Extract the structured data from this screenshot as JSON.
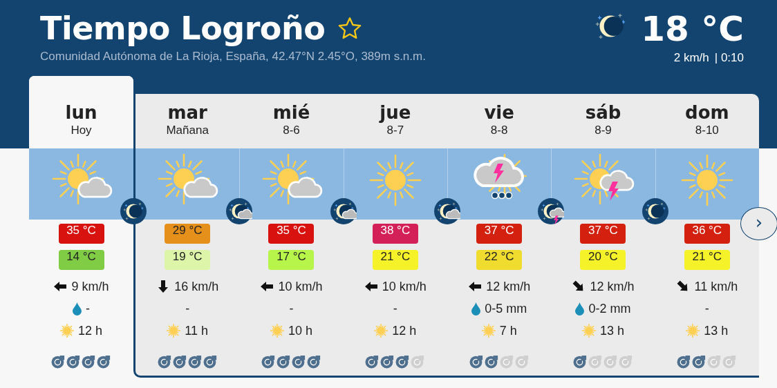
{
  "header": {
    "title": "Tiempo Logroño",
    "favorite": false,
    "subtitle": "Comunidad Autónoma de La Rioja, España, 42.47°N 2.45°O, 389m s.n.m.",
    "current": {
      "icon": {
        "kind": "moon"
      },
      "temperature": "18 °C",
      "wind": "2 km/h",
      "time": "| 0:10"
    }
  },
  "days": [
    {
      "name": "lun",
      "date": "Hoy",
      "selected": true,
      "weather_icon": {
        "kind": "sun_cloud"
      },
      "night_icon": {
        "kind": "moon"
      },
      "max": {
        "text": "35 °C",
        "color": "#d7120f"
      },
      "min": {
        "text": "14 °C",
        "color": "#80cc45"
      },
      "wind": "9 km/h",
      "wind_arrow": {
        "kind": "west"
      },
      "rain": "-",
      "rain_drop": true,
      "sun": "12 h",
      "stars": 4
    },
    {
      "name": "mar",
      "date": "Mañana",
      "selected": false,
      "weather_icon": {
        "kind": "sun_cloud"
      },
      "night_icon": {
        "kind": "moon_cloud"
      },
      "max": {
        "text": "29 °C",
        "color": "#e6901c"
      },
      "min": {
        "text": "19 °C",
        "color": "#dcf5a9"
      },
      "wind": "16 km/h",
      "wind_arrow": {
        "kind": "south"
      },
      "rain": "-",
      "rain_drop": false,
      "sun": "11 h",
      "stars": 4
    },
    {
      "name": "mié",
      "date": "8-6",
      "selected": false,
      "weather_icon": {
        "kind": "sun_cloud"
      },
      "night_icon": {
        "kind": "moon_cloud"
      },
      "max": {
        "text": "35 °C",
        "color": "#d7120f"
      },
      "min": {
        "text": "17 °C",
        "color": "#b8f54a"
      },
      "wind": "10 km/h",
      "wind_arrow": {
        "kind": "west"
      },
      "rain": "-",
      "rain_drop": false,
      "sun": "10 h",
      "stars": 4
    },
    {
      "name": "jue",
      "date": "8-7",
      "selected": false,
      "weather_icon": {
        "kind": "sun"
      },
      "night_icon": {
        "kind": "moon_cloud"
      },
      "max": {
        "text": "38 °C",
        "color": "#d42059"
      },
      "min": {
        "text": "21 °C",
        "color": "#f5f22a"
      },
      "wind": "10 km/h",
      "wind_arrow": {
        "kind": "west"
      },
      "rain": "-",
      "rain_drop": false,
      "sun": "12 h",
      "stars": 3
    },
    {
      "name": "vie",
      "date": "8-8",
      "selected": false,
      "weather_icon": {
        "kind": "storm_rain"
      },
      "night_icon": {
        "kind": "moon_storm"
      },
      "max": {
        "text": "37 °C",
        "color": "#d4210f"
      },
      "min": {
        "text": "22 °C",
        "color": "#efdc2f"
      },
      "wind": "12 km/h",
      "wind_arrow": {
        "kind": "west"
      },
      "rain": "0-5 mm",
      "rain_drop": true,
      "sun": "7 h",
      "stars": 2
    },
    {
      "name": "sáb",
      "date": "8-9",
      "selected": false,
      "weather_icon": {
        "kind": "sun_storm"
      },
      "night_icon": {
        "kind": "moon"
      },
      "max": {
        "text": "37 °C",
        "color": "#d4210f"
      },
      "min": {
        "text": "20 °C",
        "color": "#f5f22a"
      },
      "wind": "12 km/h",
      "wind_arrow": {
        "kind": "southeast"
      },
      "rain": "0-2 mm",
      "rain_drop": true,
      "sun": "13 h",
      "stars": 1
    },
    {
      "name": "dom",
      "date": "8-10",
      "selected": false,
      "weather_icon": {
        "kind": "sun"
      },
      "max": {
        "text": "36 °C",
        "color": "#d4210f"
      },
      "min": {
        "text": "21 °C",
        "color": "#f5f22a"
      },
      "wind": "11 km/h",
      "wind_arrow": {
        "kind": "southeast"
      },
      "rain": "-",
      "rain_drop": false,
      "sun": "13 h",
      "stars": 2
    }
  ],
  "next_button": "›"
}
